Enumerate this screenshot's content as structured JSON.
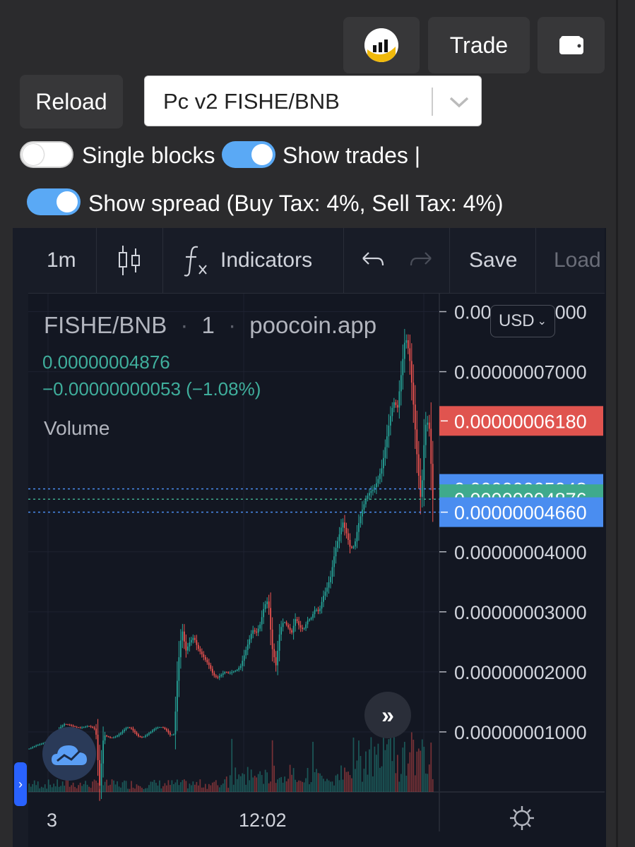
{
  "header": {
    "logo_icon": "poocoin-logo-icon",
    "trade_label": "Trade",
    "wallet_icon": "wallet-icon"
  },
  "controls": {
    "reload_label": "Reload",
    "pair_select": "Pc v2 FISHE/BNB",
    "single_blocks_label": "Single blocks",
    "single_blocks_on": false,
    "show_trades_label": "Show trades |",
    "show_trades_on": true,
    "show_spread_label": "Show spread (Buy Tax: 4%, Sell Tax: 4%)",
    "show_spread_on": true
  },
  "toolbar": {
    "interval": "1m",
    "indicators_label": "Indicators",
    "save_label": "Save",
    "load_label": "Load"
  },
  "legend": {
    "pair": "FISHE/BNB",
    "interval": "1",
    "source": "poocoin.app",
    "sep": "·",
    "last_price": "0.00000004876",
    "change": "−0.00000000053 (−1.08%)",
    "volume_label": "Volume"
  },
  "currency_button": "USD",
  "colors": {
    "up": "#26a69a",
    "down": "#ef5350",
    "sell_tag": "#e0544f",
    "buy_tag": "#4a8df0",
    "last_tag": "#3faa8c",
    "chart_bg": "#131722"
  },
  "chart_data": {
    "type": "candlestick",
    "title": "FISHE/BNB · 1 · poocoin.app",
    "y_range": [
      0,
      8.3e-08
    ],
    "y_ticks": [
      {
        "v": 1e-08,
        "label": "0.00000001000"
      },
      {
        "v": 2e-08,
        "label": "0.00000002000"
      },
      {
        "v": 3e-08,
        "label": "0.00000003000"
      },
      {
        "v": 4e-08,
        "label": "0.00000004000"
      },
      {
        "v": 7e-08,
        "label": "0.00000007000"
      },
      {
        "v": 8e-08,
        "label": "0.00000008000"
      }
    ],
    "x_ticks": [
      {
        "label": "3",
        "pos": 0.0
      },
      {
        "label": "12:02",
        "pos": 0.5
      }
    ],
    "price_tags": [
      {
        "v": 6.18e-08,
        "label": "0.00000006180",
        "kind": "sell"
      },
      {
        "v": 5.048e-08,
        "label": "0.00000005048",
        "kind": "buy"
      },
      {
        "v": 4.876e-08,
        "label": "0.00000004876",
        "kind": "last"
      },
      {
        "v": 4.66e-08,
        "label": "0.00000004660",
        "kind": "buy"
      }
    ],
    "close_path": [
      7.2e-09,
      7.5e-09,
      7.8e-09,
      8e-09,
      8.2e-09,
      8.5e-09,
      9.2e-09,
      9.8e-09,
      1.08e-08,
      1.13e-08,
      1.12e-08,
      1.1e-08,
      1.08e-08,
      1.07e-08,
      1.08e-08,
      1.1e-08,
      1.08e-08,
      1.04e-08,
      9.8e-10,
      9.5e-09,
      9.2e-09,
      9e-09,
      9.2e-09,
      9.6e-09,
      1.02e-08,
      1.08e-08,
      1.06e-08,
      9.9e-09,
      9.2e-09,
      9.1e-09,
      9.5e-09,
      1e-08,
      1.05e-08,
      1.08e-08,
      1.08e-08,
      1.03e-08,
      9.5e-09,
      9.6e-09,
      2.1e-08,
      2.72e-08,
      2.35e-08,
      2.5e-08,
      2.58e-08,
      2.4e-08,
      2.3e-08,
      2.2e-08,
      2.1e-08,
      1.95e-08,
      1.9e-08,
      1.95e-08,
      2e-08,
      1.98e-08,
      2e-08,
      2.03e-08,
      2.1e-08,
      2.3e-08,
      2.5e-08,
      2.7e-08,
      2.65e-08,
      2.8e-08,
      3.1e-08,
      3.2e-08,
      2.4e-08,
      2.1e-08,
      2.7e-08,
      2.85e-08,
      2.75e-08,
      2.65e-08,
      2.9e-08,
      2.75e-08,
      2.7e-08,
      2.85e-08,
      2.9e-08,
      3.05e-08,
      3e-08,
      3.25e-08,
      3.4e-08,
      3.6e-08,
      4e-08,
      4.25e-08,
      4.5e-08,
      4.3e-08,
      4.05e-08,
      4.1e-08,
      4.45e-08,
      4.7e-08,
      4.9e-08,
      5e-08,
      5.05e-08,
      5.2e-08,
      5.4e-08,
      5.8e-08,
      6.2e-08,
      6.5e-08,
      6.4e-08,
      7e-08,
      7.6e-08,
      7.3e-08,
      6.5e-08,
      5.58e-08,
      4.8e-08,
      6.1e-08,
      6.18e-08,
      4.88e-08
    ]
  }
}
